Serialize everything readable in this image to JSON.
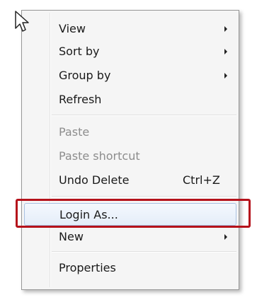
{
  "menu": {
    "items": [
      {
        "label": "View",
        "shortcut": "",
        "submenu": true,
        "disabled": false
      },
      {
        "label": "Sort by",
        "shortcut": "",
        "submenu": true,
        "disabled": false
      },
      {
        "label": "Group by",
        "shortcut": "",
        "submenu": true,
        "disabled": false
      },
      {
        "label": "Refresh",
        "shortcut": "",
        "submenu": false,
        "disabled": false
      },
      {
        "label": "Paste",
        "shortcut": "",
        "submenu": false,
        "disabled": true
      },
      {
        "label": "Paste shortcut",
        "shortcut": "",
        "submenu": false,
        "disabled": true
      },
      {
        "label": "Undo Delete",
        "shortcut": "Ctrl+Z",
        "submenu": false,
        "disabled": false
      },
      {
        "label": "Login As...",
        "shortcut": "",
        "submenu": false,
        "disabled": false,
        "highlighted": true
      },
      {
        "label": "New",
        "shortcut": "",
        "submenu": true,
        "disabled": false
      },
      {
        "label": "Properties",
        "shortcut": "",
        "submenu": false,
        "disabled": false
      }
    ]
  },
  "icons": {
    "cursor": "mouse-pointer-icon",
    "submenu_arrow": "chevron-right-icon"
  },
  "colors": {
    "annotation_box": "#b5121b",
    "hover_border": "#a9c1e2",
    "disabled_text": "#8d8d8d"
  }
}
